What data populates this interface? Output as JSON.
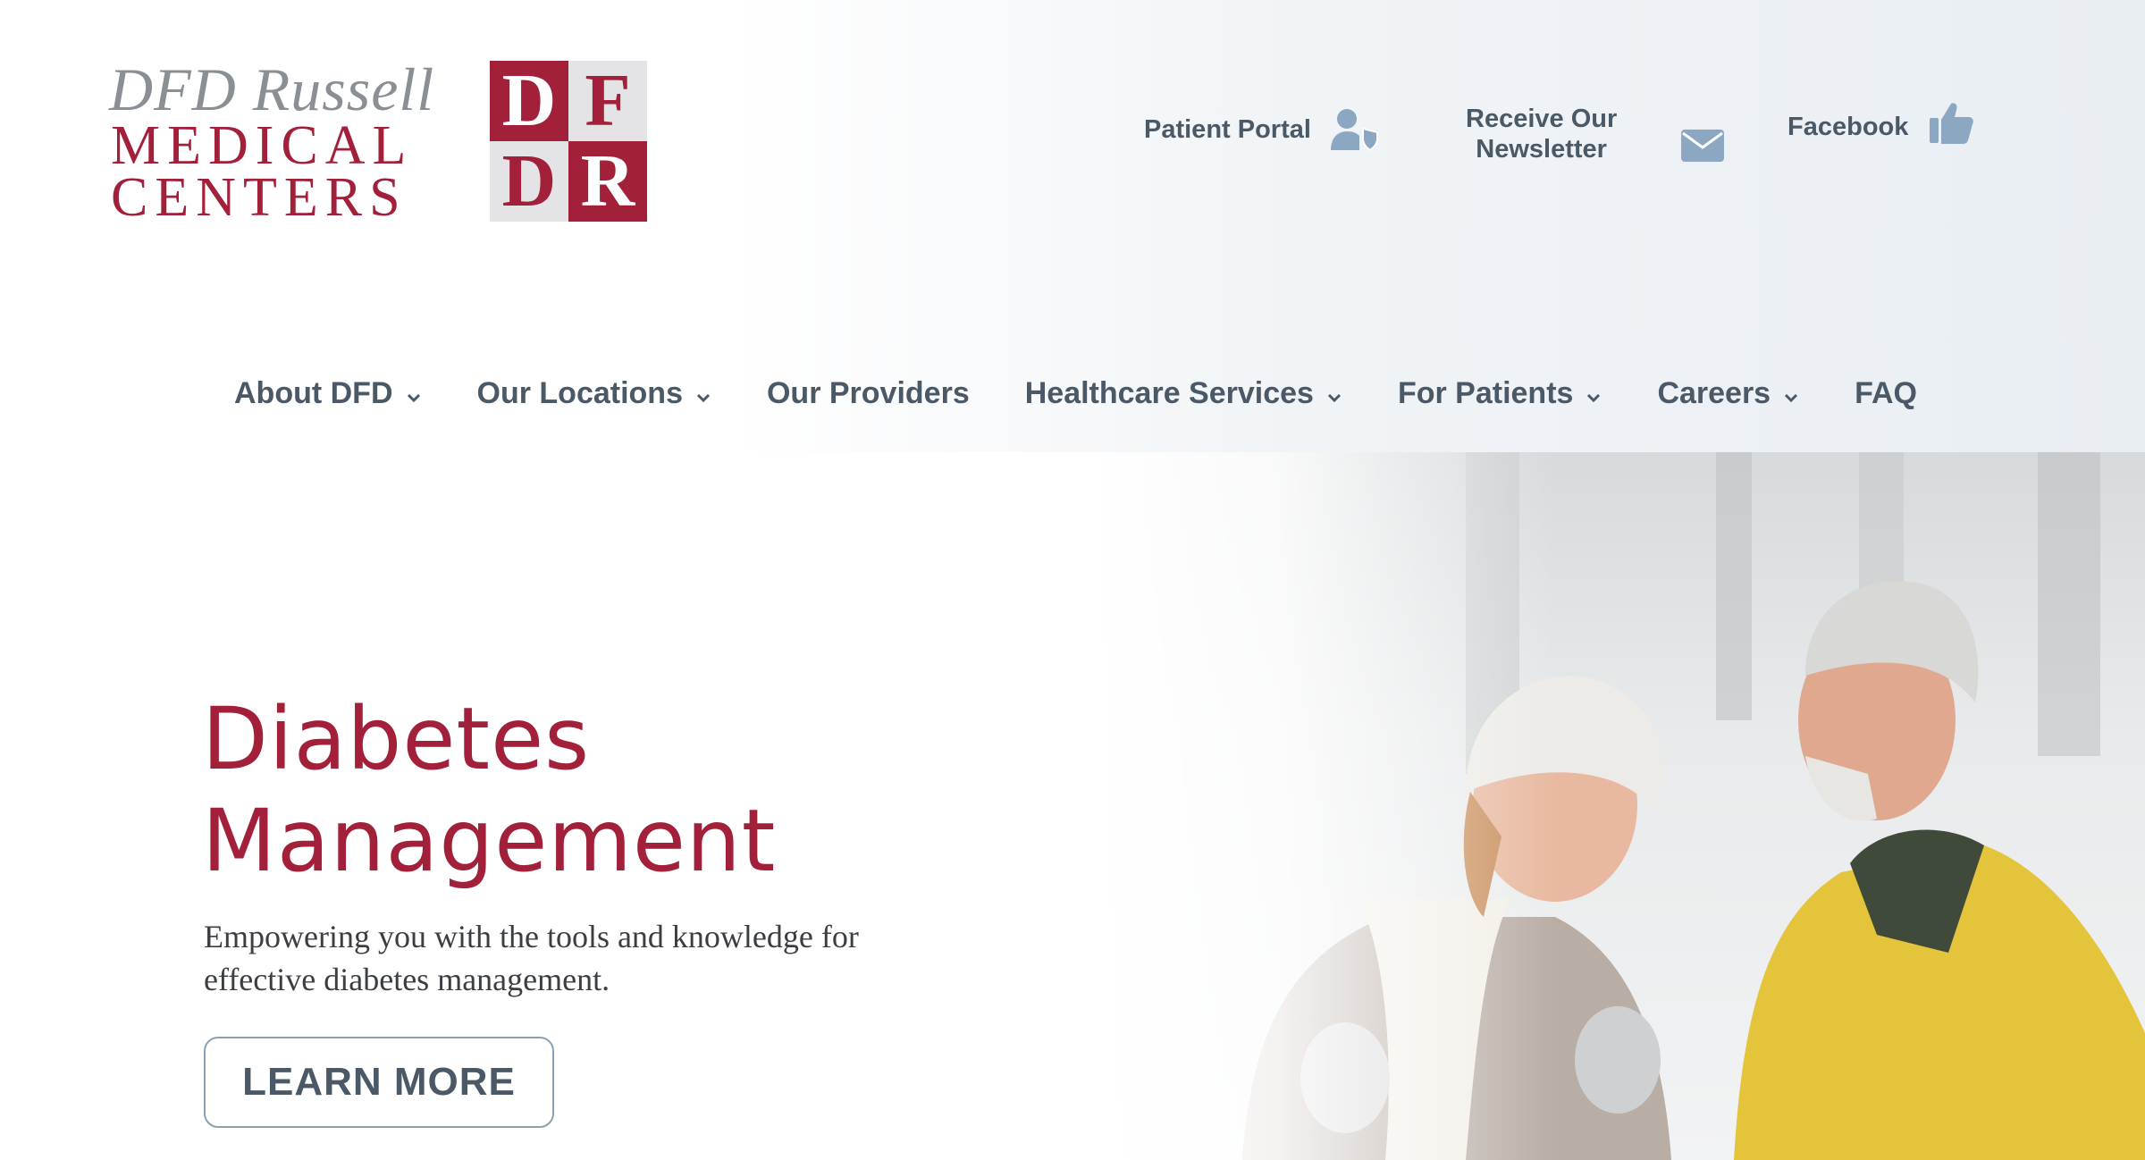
{
  "logo": {
    "script_text": "DFD Russell",
    "line1": "MEDICAL",
    "line2": "CENTERS",
    "mark": [
      "D",
      "F",
      "D",
      "R"
    ]
  },
  "utility": {
    "patient_portal": "Patient Portal",
    "newsletter_line1": "Receive Our",
    "newsletter_line2": "Newsletter",
    "facebook": "Facebook"
  },
  "nav": {
    "items": [
      {
        "label": "About DFD",
        "dropdown": true
      },
      {
        "label": "Our Locations",
        "dropdown": true
      },
      {
        "label": "Our Providers",
        "dropdown": false
      },
      {
        "label": "Healthcare Services",
        "dropdown": true
      },
      {
        "label": "For Patients",
        "dropdown": true
      },
      {
        "label": "Careers",
        "dropdown": true
      },
      {
        "label": "FAQ",
        "dropdown": false
      }
    ]
  },
  "hero": {
    "title_line1": "Diabetes",
    "title_line2": "Management",
    "subtitle": "Empowering you with the tools and knowledge for effective diabetes management.",
    "cta_label": "LEARN MORE"
  },
  "icons": {
    "patient_portal": "user-shield-icon",
    "newsletter": "envelope-icon",
    "facebook": "thumbs-up-icon",
    "dropdown": "chevron-down-icon"
  },
  "colors": {
    "brand_red": "#a3203a",
    "nav_text": "#4b5967",
    "icon_blue": "#8ba7c1",
    "button_border": "#8aa1b3"
  }
}
